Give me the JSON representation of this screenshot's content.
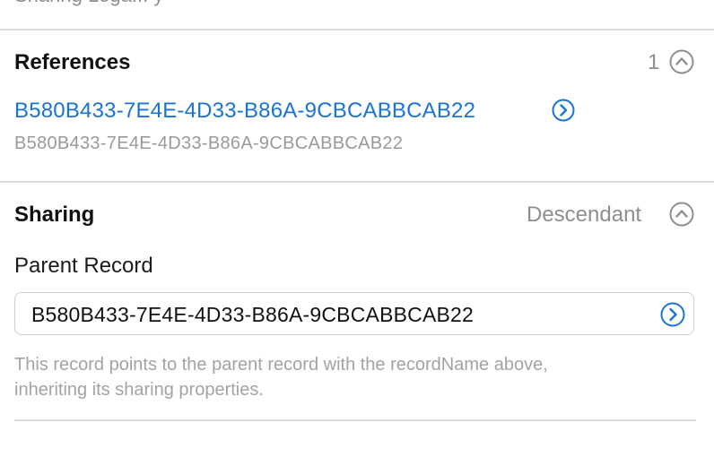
{
  "top_cut_text": "Sharing Lega... y",
  "references": {
    "title": "References",
    "count": "1",
    "link_text": "B580B433-7E4E-4D33-B86A-9CBCABBCAB22",
    "sub_text": "B580B433-7E4E-4D33-B86A-9CBCABBCAB22"
  },
  "sharing": {
    "title": "Sharing",
    "mode": "Descendant",
    "parent_label": "Parent Record",
    "parent_value": "B580B433-7E4E-4D33-B86A-9CBCABBCAB22",
    "help_line1": "This record points to the parent record with the recordName above,",
    "help_line2": "inheriting its sharing properties."
  },
  "colors": {
    "link": "#1a73d6",
    "muted": "#8e8e8e",
    "divider": "#dcdcdc"
  },
  "icons": {
    "collapse": "chevron-up-circle-icon",
    "navigate": "chevron-right-circle-icon"
  }
}
